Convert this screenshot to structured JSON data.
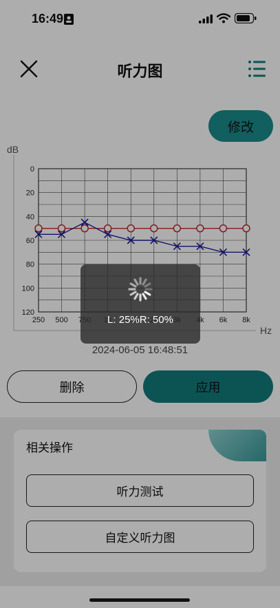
{
  "status_bar": {
    "time": "16:49"
  },
  "header": {
    "title": "听力图"
  },
  "edit_button": "修改",
  "chart_data": {
    "type": "line",
    "ylabel": "dB",
    "xlabel": "Hz",
    "x": [
      "250",
      "500",
      "750",
      "1k",
      "1.5k",
      "2k",
      "3k",
      "4k",
      "6k",
      "8k"
    ],
    "ylim": [
      0,
      120
    ],
    "y_inverted": true,
    "yticks": [
      0,
      20,
      40,
      60,
      80,
      100,
      120
    ],
    "grid": true,
    "series": [
      {
        "marker": "o",
        "color": "#c0282d",
        "values": [
          50,
          50,
          50,
          50,
          50,
          50,
          50,
          50,
          50,
          50
        ]
      },
      {
        "marker": "x",
        "color": "#1c1c9c",
        "values": [
          55,
          55,
          45,
          55,
          60,
          60,
          65,
          65,
          70,
          70
        ]
      }
    ]
  },
  "timestamp": "2024-06-05 16:48:51",
  "buttons": {
    "delete": "删除",
    "apply": "应用"
  },
  "related": {
    "title": "相关操作",
    "items": [
      "听力测试",
      "自定义听力图"
    ]
  },
  "loading": {
    "text": "L: 25%R: 50%"
  }
}
